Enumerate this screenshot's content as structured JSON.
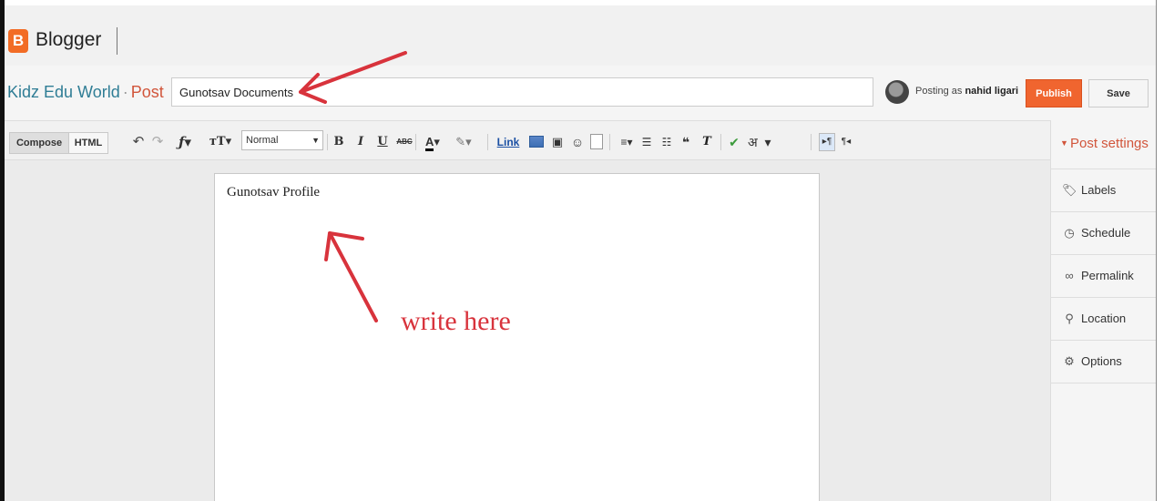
{
  "app": {
    "brand": "Blogger",
    "logo_letter": "B"
  },
  "post": {
    "blog_name": "Kidz Edu World",
    "separator": "·",
    "section": "Post",
    "title_value": "Gunotsav Documents",
    "body_text": "Gunotsav Profile"
  },
  "account": {
    "posting_prefix": "Posting as",
    "user": "nahid ligari"
  },
  "actions": {
    "publish_label": "Publish",
    "save_label": "Save"
  },
  "toolbar": {
    "compose_label": "Compose",
    "html_label": "HTML",
    "format_value": "Normal",
    "link_label": "Link",
    "icons": [
      "undo-icon",
      "redo-icon",
      "font-family-icon",
      "font-size-icon",
      "bold-icon",
      "italic-icon",
      "underline-icon",
      "strikethrough-icon",
      "text-color-icon",
      "highlight-color-icon",
      "image-icon",
      "video-icon",
      "emoji-icon",
      "jump-break-icon",
      "align-icon",
      "numbered-list-icon",
      "bullet-list-icon",
      "quote-icon",
      "clear-format-icon",
      "spellcheck-icon",
      "input-language-icon",
      "ltr-icon",
      "rtl-icon"
    ]
  },
  "sidebar": {
    "header": "Post settings",
    "items": [
      {
        "label": "Labels",
        "icon": "tag-icon"
      },
      {
        "label": "Schedule",
        "icon": "clock-icon"
      },
      {
        "label": "Permalink",
        "icon": "link-icon"
      },
      {
        "label": "Location",
        "icon": "pin-icon"
      },
      {
        "label": "Options",
        "icon": "gear-icon"
      }
    ]
  },
  "annotation": {
    "text": "write here",
    "color": "#d8333c"
  },
  "colors": {
    "accent": "#f0652f",
    "blog_name": "#2f7d95",
    "post_word": "#d1553b"
  }
}
